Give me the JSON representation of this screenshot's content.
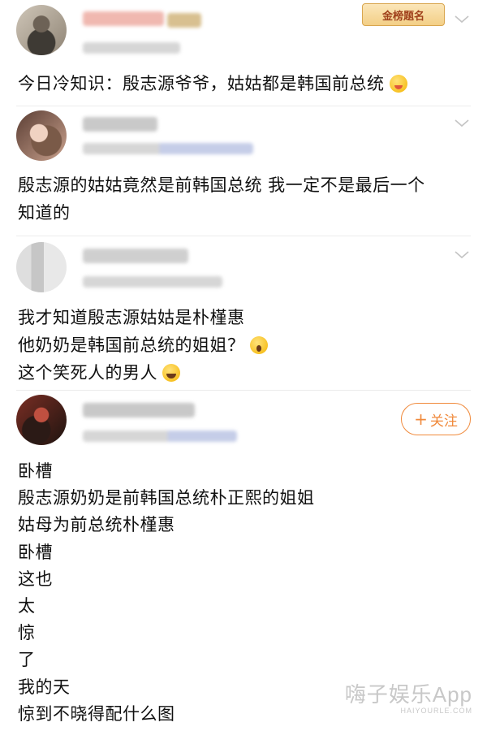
{
  "posts": [
    {
      "badge": "金榜题名",
      "content": [
        "今日冷知识：殷志源爷爷，姑姑都是韩国前总统"
      ]
    },
    {
      "content": [
        "殷志源的姑姑竟然是前韩国总统 我一定不是最后一个",
        "知道的"
      ]
    },
    {
      "content": [
        "我才知道殷志源姑姑是朴槿惠",
        "他奶奶是韩国前总统的姐姐？",
        "这个笑死人的男人"
      ]
    },
    {
      "follow_label": "关注",
      "content": [
        "卧槽",
        "殷志源奶奶是前韩国总统朴正熙的姐姐",
        "姑母为前总统朴槿惠",
        "卧槽",
        "这也",
        "太",
        "惊",
        "了",
        "我的天",
        "惊到不晓得配什么图"
      ]
    }
  ],
  "watermark": {
    "main": "嗨子娱乐App",
    "sub": "HAIYOURLE.COM"
  },
  "icons": {
    "chevron": "chevron-down-icon",
    "plus": "plus-icon",
    "emoji_1": "yum-face-emoji",
    "emoji_2": "astonished-face-emoji",
    "emoji_3": "laughing-crying-face-emoji"
  },
  "colors": {
    "follow_accent": "#f08a3c",
    "text": "#111111",
    "divider": "#ececec"
  }
}
